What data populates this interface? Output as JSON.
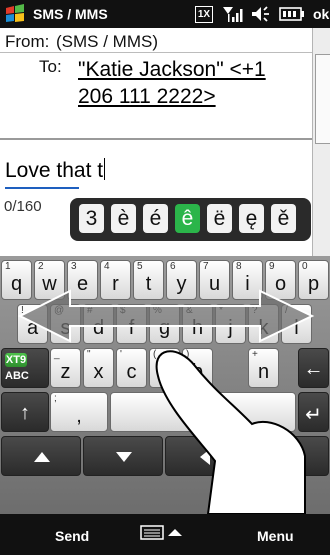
{
  "status_bar": {
    "title": "SMS / MMS",
    "ok_label": "ok",
    "icons": [
      "windows-flag-icon",
      "network-1x-icon",
      "signal-icon",
      "volume-icon",
      "battery-icon"
    ],
    "network_label": "1X"
  },
  "compose": {
    "from_label": "From:",
    "from_value": "(SMS / MMS)",
    "to_label": "To:",
    "recipient_line1": "\"Katie Jackson\" <+1",
    "recipient_line2": "206 111 2222>",
    "body_text": "Love that t",
    "char_counter": "0/160"
  },
  "suggestions": [
    "3",
    "è",
    "é",
    "ê",
    "ë",
    "ę",
    "ě"
  ],
  "keyboard": {
    "row1": [
      {
        "k": "q",
        "s": "1"
      },
      {
        "k": "w",
        "s": "2"
      },
      {
        "k": "e",
        "s": "3"
      },
      {
        "k": "r",
        "s": "4"
      },
      {
        "k": "t",
        "s": "5"
      },
      {
        "k": "y",
        "s": "6"
      },
      {
        "k": "u",
        "s": "7"
      },
      {
        "k": "i",
        "s": "8"
      },
      {
        "k": "o",
        "s": "9"
      },
      {
        "k": "p",
        "s": "0"
      }
    ],
    "row2": [
      {
        "k": "a",
        "s": "!"
      },
      {
        "k": "s",
        "s": "@"
      },
      {
        "k": "d",
        "s": "#"
      },
      {
        "k": "f",
        "s": "$"
      },
      {
        "k": "g",
        "s": "%"
      },
      {
        "k": "h",
        "s": "&"
      },
      {
        "k": "j",
        "s": "*"
      },
      {
        "k": "k",
        "s": "?"
      },
      {
        "k": "l",
        "s": "/"
      }
    ],
    "row3": [
      {
        "k": "z",
        "s": "_"
      },
      {
        "k": "x",
        "s": "\""
      },
      {
        "k": "c",
        "s": "'"
      },
      {
        "k": "v",
        "s": "("
      },
      {
        "k": "b",
        "s": ")"
      },
      {
        "k": "n",
        "s": "+"
      }
    ],
    "xt9_label_top": "XT9",
    "xt9_label_bottom": "ABC",
    "comma": ",",
    "comma_sub": ";",
    "space_symbol": "⎵",
    "shift_symbol": "↑",
    "enter_symbol": "↵",
    "backspace_symbol": "←"
  },
  "softkeys": {
    "left": "Send",
    "right": "Menu"
  }
}
